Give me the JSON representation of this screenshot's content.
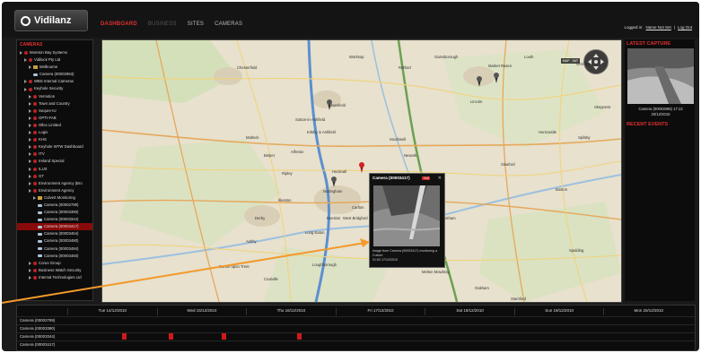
{
  "app": {
    "logo_text": "Vidilanz",
    "nav": [
      {
        "label": "DASHBOARD",
        "state": "active"
      },
      {
        "label": "BUSINESS",
        "state": "muted"
      },
      {
        "label": "SITES",
        "state": "normal"
      },
      {
        "label": "CAMERAS",
        "state": "normal"
      }
    ],
    "user": {
      "prefix": "Logged in:",
      "name": "Name Not Set",
      "sep": "|",
      "logout": "Log Out"
    }
  },
  "sidebar": {
    "title": "CAMERAS",
    "items": [
      {
        "label": "Moreton Bay Systems",
        "indent": 0,
        "icon": "bug"
      },
      {
        "label": "Vidilock Pty Ltd",
        "indent": 1,
        "icon": "bug"
      },
      {
        "label": "Melbourne",
        "indent": 2,
        "icon": "folder"
      },
      {
        "label": "Camera (00002963)",
        "indent": 3,
        "icon": "cam"
      },
      {
        "label": "WBS Internal Cameras",
        "indent": 1,
        "icon": "bug"
      },
      {
        "label": "Keyhole Security",
        "indent": 1,
        "icon": "bug"
      },
      {
        "label": "Vernotion",
        "indent": 2,
        "icon": "bug"
      },
      {
        "label": "Town and Country",
        "indent": 2,
        "icon": "bug"
      },
      {
        "label": "Sequre-IU",
        "indent": 2,
        "icon": "bug"
      },
      {
        "label": "OPTI-FAB",
        "indent": 2,
        "icon": "bug"
      },
      {
        "label": "Ollex Limited",
        "indent": 2,
        "icon": "bug"
      },
      {
        "label": "Logix",
        "indent": 2,
        "icon": "bug"
      },
      {
        "label": "KHS",
        "indent": 2,
        "icon": "bug"
      },
      {
        "label": "Keyhole WTW Dashboard",
        "indent": 2,
        "icon": "bug"
      },
      {
        "label": "ITV",
        "indent": 2,
        "icon": "bug"
      },
      {
        "label": "Ireland Special",
        "indent": 2,
        "icon": "bug"
      },
      {
        "label": "ILUX",
        "indent": 2,
        "icon": "bug"
      },
      {
        "label": "GT",
        "indent": 2,
        "icon": "bug"
      },
      {
        "label": "Environment Agency (Bro",
        "indent": 2,
        "icon": "bug"
      },
      {
        "label": "Environment Agency",
        "indent": 2,
        "icon": "bug"
      },
      {
        "label": "Culvert Monitoring",
        "indent": 3,
        "icon": "folder"
      },
      {
        "label": "Camera (00002789)",
        "indent": 4,
        "icon": "cam"
      },
      {
        "label": "Camera (00003380)",
        "indent": 4,
        "icon": "cam"
      },
      {
        "label": "Camera (00003344)",
        "indent": 4,
        "icon": "cam"
      },
      {
        "label": "Camera (00003417)",
        "indent": 4,
        "icon": "cam",
        "selected": true
      },
      {
        "label": "Camera (00003464)",
        "indent": 4,
        "icon": "cam"
      },
      {
        "label": "Camera (00003480)",
        "indent": 4,
        "icon": "cam"
      },
      {
        "label": "Camera (00003494)",
        "indent": 4,
        "icon": "cam"
      },
      {
        "label": "Camera (00003460)",
        "indent": 4,
        "icon": "cam"
      },
      {
        "label": "Corus Group",
        "indent": 2,
        "icon": "bug"
      },
      {
        "label": "Business Watch Security",
        "indent": 2,
        "icon": "bug"
      },
      {
        "label": "Internal Technologies Ltd",
        "indent": 2,
        "icon": "bug"
      }
    ]
  },
  "map": {
    "places": [
      "Chesterfield",
      "Mansfield",
      "Sutton-in-Ashfield",
      "Kirkby in Ashfield",
      "Hucknall",
      "Nottingham",
      "Newark",
      "Grantham",
      "Derby",
      "Long Eaton",
      "Loughborough",
      "Melton Mowbray",
      "Burton upon Trent",
      "Grimsby",
      "Lincoln",
      "Sleaford",
      "Boston",
      "Spalding",
      "Stamford",
      "Coalville",
      "Oakham",
      "Retford",
      "Gainsborough",
      "Worksop",
      "Bingham",
      "Carlton",
      "Ripley",
      "Alfreton",
      "Ilkeston",
      "West Bridgford",
      "Beeston",
      "Ashby",
      "Belper",
      "Matlock",
      "Southwell",
      "Louth",
      "Skegness",
      "Horncastle",
      "Market Rasen",
      "Spilsby"
    ],
    "type_buttons": [
      "MAP",
      "SAT"
    ],
    "popup": {
      "title": "Camera (00003417)",
      "badge": "TAS",
      "close": "✕",
      "caption_line1": "Image from Camera (00003417) monitoring a Culvert",
      "caption_line2": "01:52 17/12/2010"
    }
  },
  "right_panel": {
    "latest_title": "LATEST CAPTURE",
    "latest_caption_line1": "Camera (00002696) 17:13",
    "latest_caption_line2": "20/12/2010",
    "events_title": "RECENT EVENTS"
  },
  "timeline": {
    "dates": [
      "Tue 14/12/2010",
      "Wed 15/12/2010",
      "Thu 16/12/2010",
      "Fri 17/12/2010",
      "Sat 18/12/2010",
      "Sun 19/12/2010",
      "Mon 20/12/2010"
    ],
    "rows": [
      {
        "label": "Camera (00002789)",
        "events": []
      },
      {
        "label": "Camera (00003380)",
        "events": []
      },
      {
        "label": "Camera (00003344)",
        "events": [
          0.09,
          0.165,
          0.25,
          0.37
        ]
      },
      {
        "label": "Camera (00003417)",
        "events": []
      }
    ]
  },
  "colors": {
    "accent": "#e03030",
    "selected_row": "#8a0a0a",
    "event_mark": "#d01818",
    "arrow": "#f39a2c"
  }
}
